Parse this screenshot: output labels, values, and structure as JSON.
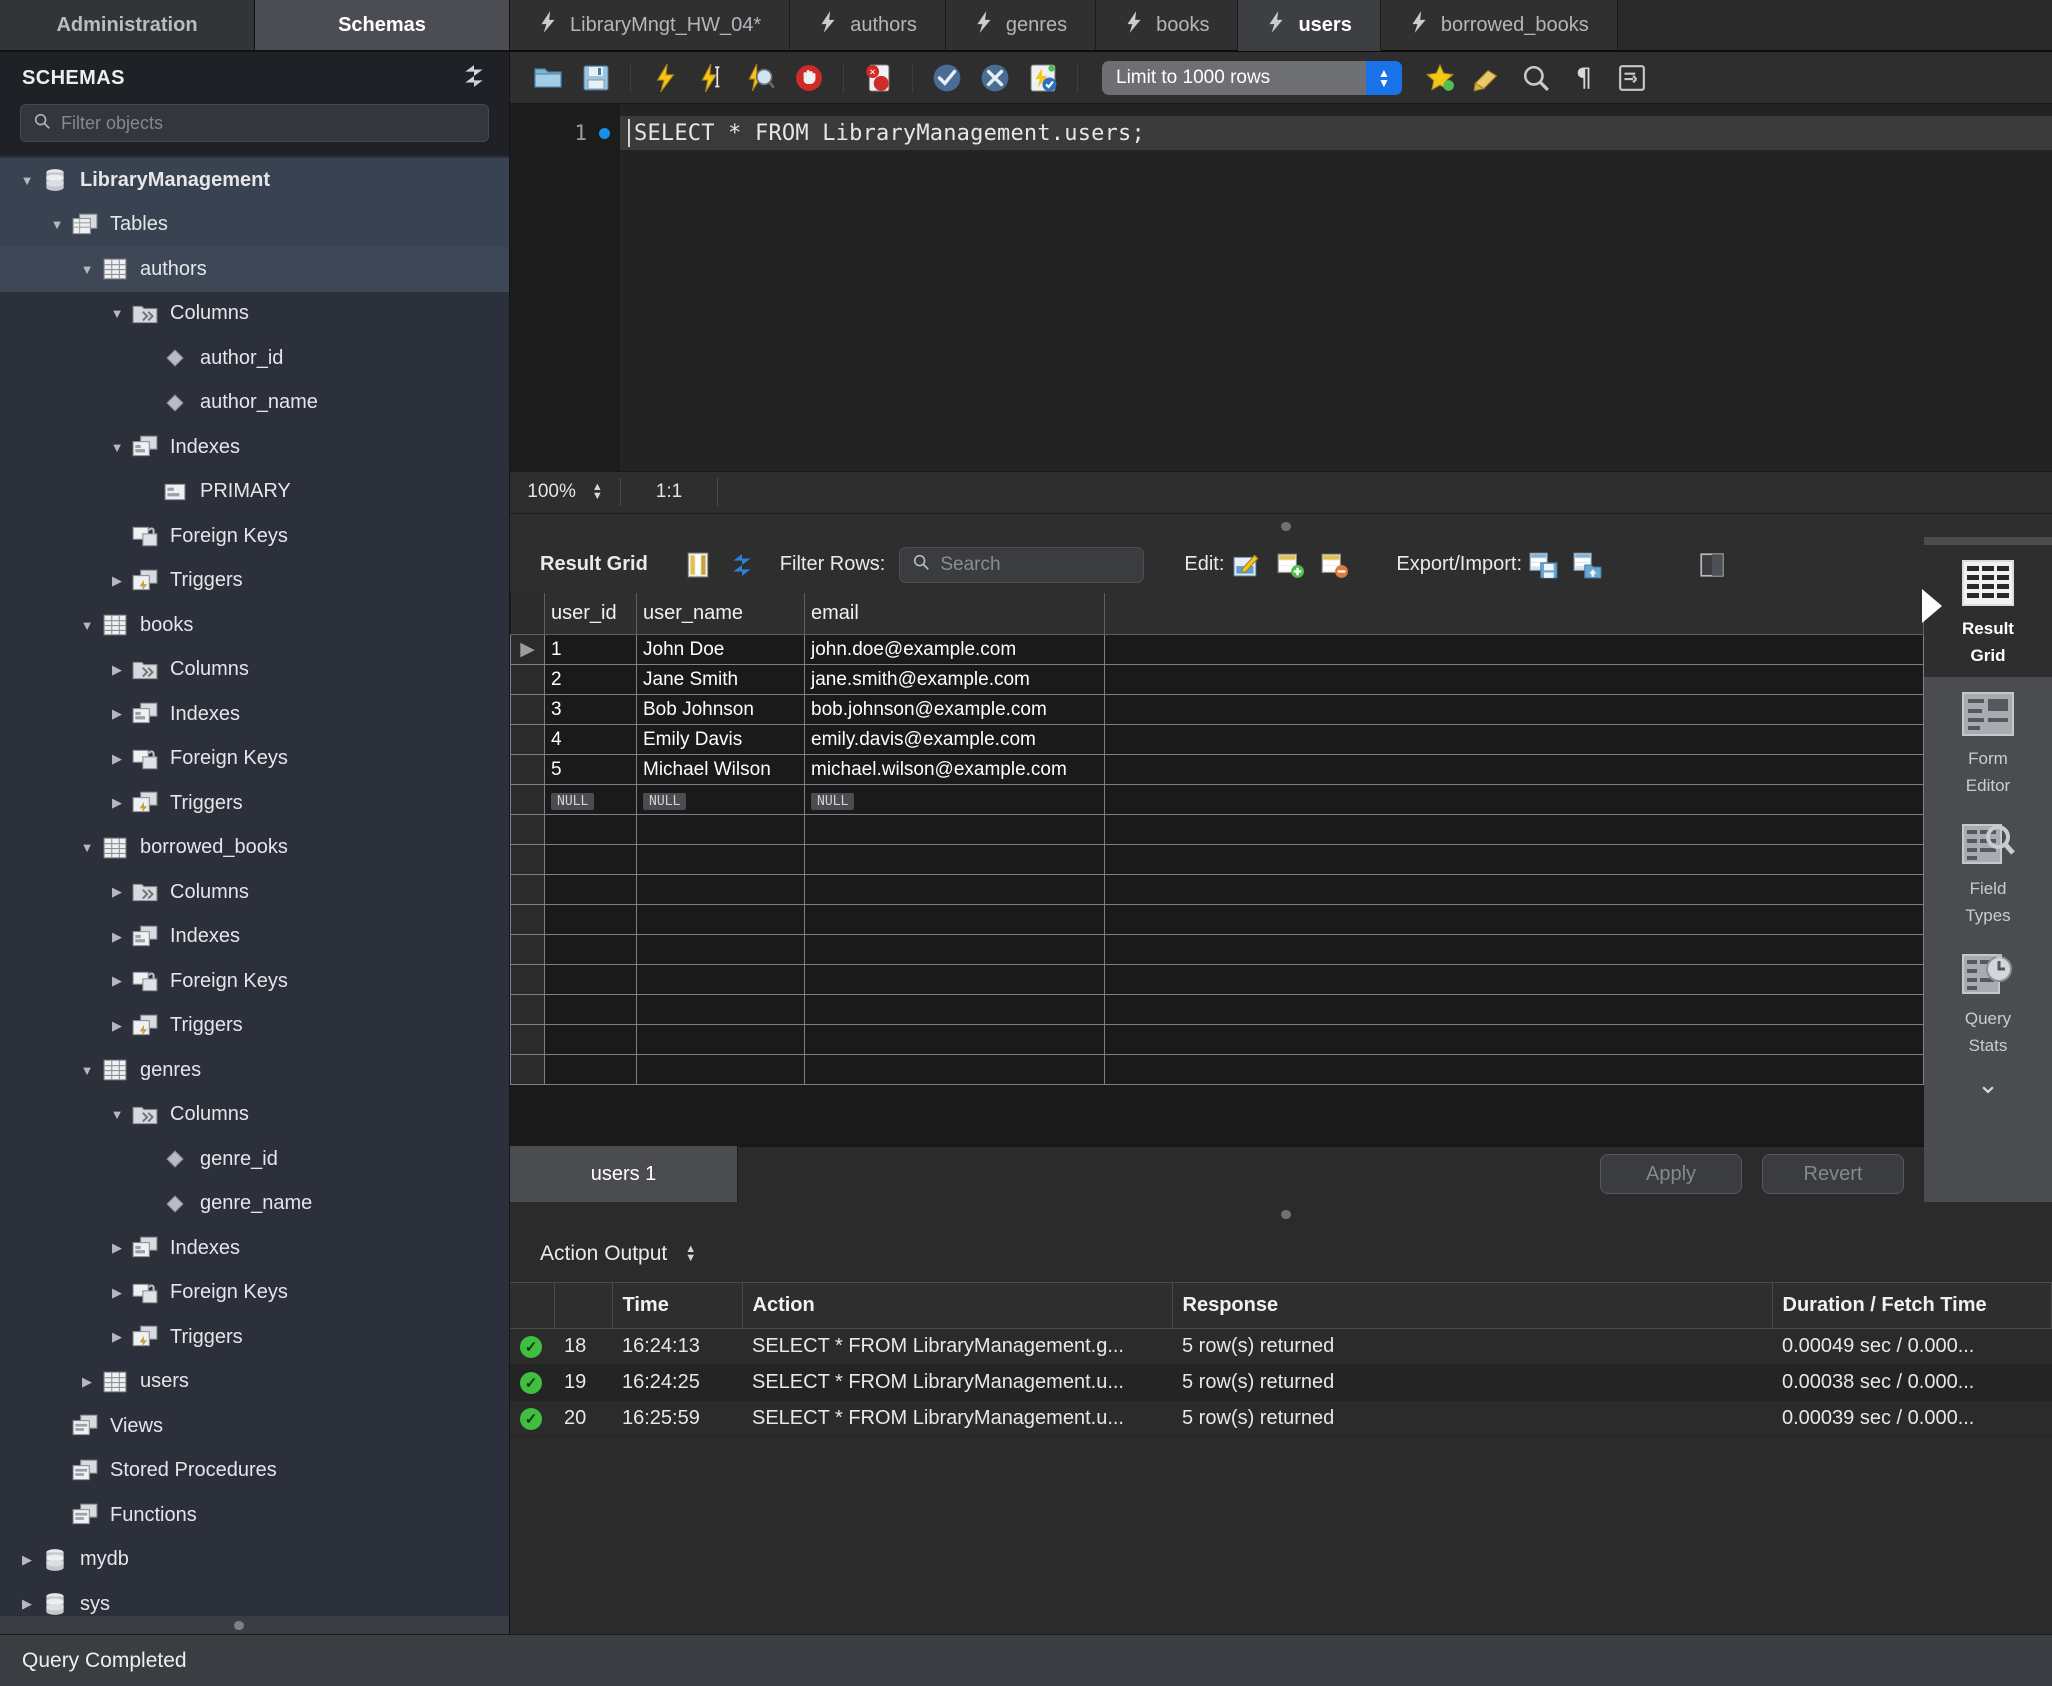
{
  "left_panel_tabs": [
    {
      "label": "Administration",
      "active": false
    },
    {
      "label": "Schemas",
      "active": true
    }
  ],
  "editor_tabs": [
    {
      "label": "LibraryMngt_HW_04*",
      "icon": "lightning-icon",
      "active": false
    },
    {
      "label": "authors",
      "icon": "lightning-icon",
      "active": false
    },
    {
      "label": "genres",
      "icon": "lightning-icon",
      "active": false
    },
    {
      "label": "books",
      "icon": "lightning-icon",
      "active": false
    },
    {
      "label": "users",
      "icon": "lightning-icon",
      "active": true
    },
    {
      "label": "borrowed_books",
      "icon": "lightning-icon",
      "active": false
    }
  ],
  "sidebar": {
    "title": "SCHEMAS",
    "refresh_icon": "refresh-icon",
    "filter_placeholder": "Filter objects",
    "filter_value": "",
    "search_icon": "search-icon",
    "tree": [
      {
        "label": "LibraryManagement",
        "icon": "database-icon",
        "depth": 0,
        "twisty": "down",
        "bold": true,
        "state": "hl"
      },
      {
        "label": "Tables",
        "icon": "folder-tables-icon",
        "depth": 1,
        "twisty": "down",
        "state": "hl"
      },
      {
        "label": "authors",
        "icon": "table-icon",
        "depth": 2,
        "twisty": "down",
        "state": "sel"
      },
      {
        "label": "Columns",
        "icon": "folder-columns-icon",
        "depth": 3,
        "twisty": "down"
      },
      {
        "label": "author_id",
        "icon": "column-icon",
        "depth": 4,
        "twisty": "none"
      },
      {
        "label": "author_name",
        "icon": "column-icon",
        "depth": 4,
        "twisty": "none"
      },
      {
        "label": "Indexes",
        "icon": "folder-indexes-icon",
        "depth": 3,
        "twisty": "down"
      },
      {
        "label": "PRIMARY",
        "icon": "index-icon",
        "depth": 4,
        "twisty": "none"
      },
      {
        "label": "Foreign Keys",
        "icon": "folder-fk-icon",
        "depth": 3,
        "twisty": "none"
      },
      {
        "label": "Triggers",
        "icon": "folder-triggers-icon",
        "depth": 3,
        "twisty": "right"
      },
      {
        "label": "books",
        "icon": "table-icon",
        "depth": 2,
        "twisty": "down"
      },
      {
        "label": "Columns",
        "icon": "folder-columns-icon",
        "depth": 3,
        "twisty": "right"
      },
      {
        "label": "Indexes",
        "icon": "folder-indexes-icon",
        "depth": 3,
        "twisty": "right"
      },
      {
        "label": "Foreign Keys",
        "icon": "folder-fk-icon",
        "depth": 3,
        "twisty": "right"
      },
      {
        "label": "Triggers",
        "icon": "folder-triggers-icon",
        "depth": 3,
        "twisty": "right"
      },
      {
        "label": "borrowed_books",
        "icon": "table-icon",
        "depth": 2,
        "twisty": "down"
      },
      {
        "label": "Columns",
        "icon": "folder-columns-icon",
        "depth": 3,
        "twisty": "right"
      },
      {
        "label": "Indexes",
        "icon": "folder-indexes-icon",
        "depth": 3,
        "twisty": "right"
      },
      {
        "label": "Foreign Keys",
        "icon": "folder-fk-icon",
        "depth": 3,
        "twisty": "right"
      },
      {
        "label": "Triggers",
        "icon": "folder-triggers-icon",
        "depth": 3,
        "twisty": "right"
      },
      {
        "label": "genres",
        "icon": "table-icon",
        "depth": 2,
        "twisty": "down"
      },
      {
        "label": "Columns",
        "icon": "folder-columns-icon",
        "depth": 3,
        "twisty": "down"
      },
      {
        "label": "genre_id",
        "icon": "column-icon",
        "depth": 4,
        "twisty": "none"
      },
      {
        "label": "genre_name",
        "icon": "column-icon",
        "depth": 4,
        "twisty": "none"
      },
      {
        "label": "Indexes",
        "icon": "folder-indexes-icon",
        "depth": 3,
        "twisty": "right"
      },
      {
        "label": "Foreign Keys",
        "icon": "folder-fk-icon",
        "depth": 3,
        "twisty": "right"
      },
      {
        "label": "Triggers",
        "icon": "folder-triggers-icon",
        "depth": 3,
        "twisty": "right"
      },
      {
        "label": "users",
        "icon": "table-icon",
        "depth": 2,
        "twisty": "right"
      },
      {
        "label": "Views",
        "icon": "folder-views-icon",
        "depth": 1,
        "twisty": "none"
      },
      {
        "label": "Stored Procedures",
        "icon": "folder-procs-icon",
        "depth": 1,
        "twisty": "none"
      },
      {
        "label": "Functions",
        "icon": "folder-funcs-icon",
        "depth": 1,
        "twisty": "none"
      },
      {
        "label": "mydb",
        "icon": "database-icon",
        "depth": 0,
        "twisty": "right"
      },
      {
        "label": "sys",
        "icon": "database-icon",
        "depth": 0,
        "twisty": "right"
      }
    ]
  },
  "toolbar": {
    "buttons": [
      {
        "name": "open-sql-file-button",
        "icon": "folder-open-icon"
      },
      {
        "name": "save-sql-file-button",
        "icon": "floppy-save-icon"
      },
      {
        "name": "execute-statement-button",
        "icon": "lightning-bolt-icon"
      },
      {
        "name": "execute-current-statement-button",
        "icon": "lightning-cursor-icon"
      },
      {
        "name": "explain-statement-button",
        "icon": "lightning-magnifier-icon"
      },
      {
        "name": "stop-execution-button",
        "icon": "stop-hand-icon"
      },
      {
        "name": "toggle-stop-on-error-button",
        "icon": "stop-on-error-icon"
      },
      {
        "name": "commit-button",
        "icon": "commit-check-icon"
      },
      {
        "name": "rollback-button",
        "icon": "rollback-x-icon"
      },
      {
        "name": "toggle-autocommit-button",
        "icon": "autocommit-icon"
      }
    ],
    "limit_label": "Limit to 1000 rows",
    "right_buttons": [
      {
        "name": "toggle-context-help-button",
        "icon": "star-help-icon"
      },
      {
        "name": "beautify-sql-button",
        "icon": "brush-icon"
      },
      {
        "name": "find-button",
        "icon": "magnifier-icon"
      },
      {
        "name": "toggle-invisible-chars-button",
        "icon": "pilcrow-icon"
      },
      {
        "name": "wrap-lines-button",
        "icon": "wrap-lines-icon"
      }
    ]
  },
  "editor": {
    "line_number": "1",
    "sql": "SELECT * FROM LibraryManagement.users;",
    "zoom": "100%",
    "cursor_position": "1:1"
  },
  "result_grid_toolbar": {
    "title": "Result Grid",
    "filter_label": "Filter Rows:",
    "search_placeholder": "Search",
    "search_value": "",
    "edit_label": "Edit:",
    "export_label": "Export/Import:",
    "icons": {
      "grid_colors": "grid-colors-icon",
      "refresh": "refresh-icon",
      "search": "search-icon",
      "edit_row": "edit-row-icon",
      "insert_row": "insert-row-icon",
      "delete_row": "delete-row-icon",
      "export_recordset": "export-recordset-icon",
      "import_recordset": "import-recordset-icon",
      "wrap_cell_content": "wrap-cell-content-icon"
    }
  },
  "result_grid": {
    "columns": [
      "user_id",
      "user_name",
      "email"
    ],
    "rows": [
      {
        "marker": "▶",
        "user_id": "1",
        "user_name": "John Doe",
        "email": "john.doe@example.com"
      },
      {
        "marker": "",
        "user_id": "2",
        "user_name": "Jane Smith",
        "email": "jane.smith@example.com"
      },
      {
        "marker": "",
        "user_id": "3",
        "user_name": "Bob Johnson",
        "email": "bob.johnson@example.com"
      },
      {
        "marker": "",
        "user_id": "4",
        "user_name": "Emily Davis",
        "email": "emily.davis@example.com"
      },
      {
        "marker": "",
        "user_id": "5",
        "user_name": "Michael Wilson",
        "email": "michael.wilson@example.com"
      }
    ],
    "null_placeholder": "NULL",
    "empty_rows": 9,
    "resultset_tab": "users 1",
    "apply_label": "Apply",
    "revert_label": "Revert"
  },
  "side_panel": {
    "tabs": [
      {
        "label_line1": "Result",
        "label_line2": "Grid",
        "icon": "result-grid-icon",
        "active": true
      },
      {
        "label_line1": "Form",
        "label_line2": "Editor",
        "icon": "form-editor-icon",
        "active": false
      },
      {
        "label_line1": "Field",
        "label_line2": "Types",
        "icon": "field-types-icon",
        "active": false
      },
      {
        "label_line1": "Query",
        "label_line2": "Stats",
        "icon": "query-stats-icon",
        "active": false
      }
    ],
    "more_icon": "chevron-down-icon"
  },
  "action_output": {
    "selector_label": "Action Output",
    "columns": [
      "",
      "",
      "Time",
      "Action",
      "Response",
      "Duration / Fetch Time"
    ],
    "rows": [
      {
        "status": "ok",
        "num": "18",
        "time": "16:24:13",
        "action": "SELECT * FROM LibraryManagement.g...",
        "response": "5 row(s) returned",
        "duration": "0.00049 sec / 0.000..."
      },
      {
        "status": "ok",
        "num": "19",
        "time": "16:24:25",
        "action": "SELECT * FROM LibraryManagement.u...",
        "response": "5 row(s) returned",
        "duration": "0.00038 sec / 0.000..."
      },
      {
        "status": "ok",
        "num": "20",
        "time": "16:25:59",
        "action": "SELECT * FROM LibraryManagement.u...",
        "response": "5 row(s) returned",
        "duration": "0.00039 sec / 0.000..."
      }
    ]
  },
  "status_bar": {
    "text": "Query Completed"
  }
}
